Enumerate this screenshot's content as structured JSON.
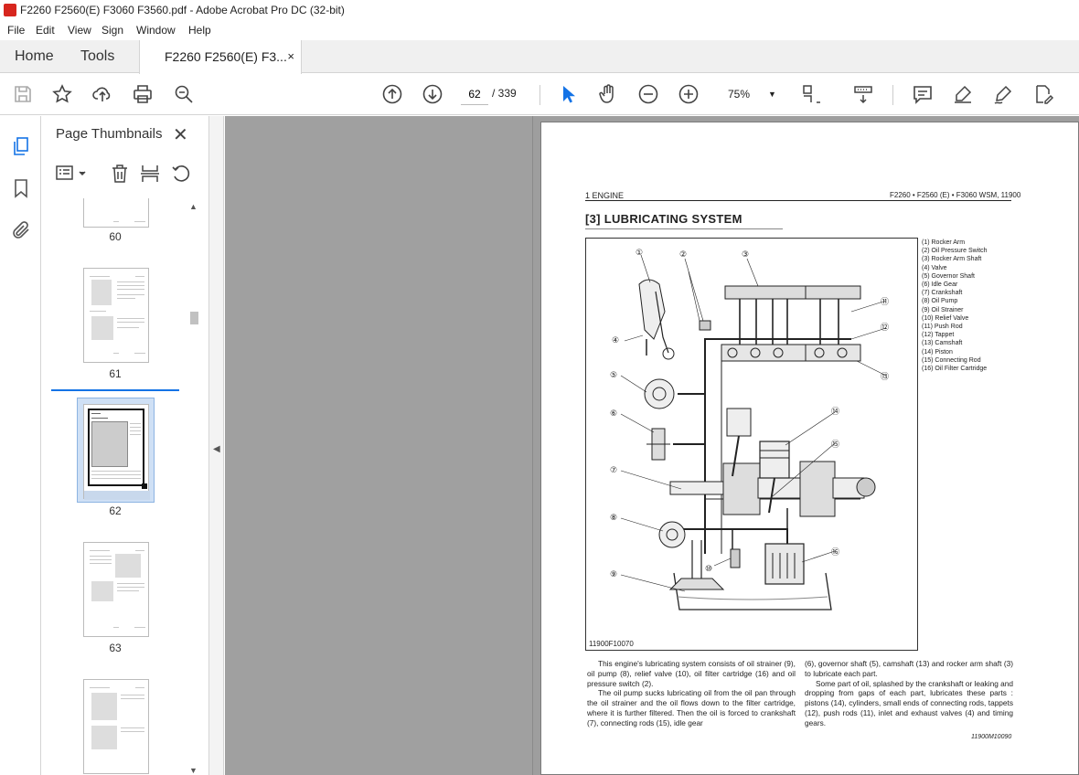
{
  "window": {
    "title": "F2260 F2560(E) F3060 F3560.pdf - Adobe Acrobat Pro DC (32-bit)"
  },
  "menu": [
    "File",
    "Edit",
    "View",
    "Sign",
    "Window",
    "Help"
  ],
  "tabs": {
    "home": "Home",
    "tools": "Tools",
    "document": "F2260 F2560(E) F3...",
    "close": "×"
  },
  "toolbar": {
    "current_page": "62",
    "total_pages": "/ 339",
    "zoom": "75%",
    "icons": [
      "save-icon",
      "star-icon",
      "upload-icon",
      "print-icon",
      "zoom-search-icon",
      "page-up-icon",
      "page-down-icon",
      "select-arrow-icon",
      "hand-icon",
      "zoom-out-icon",
      "zoom-in-icon",
      "fit-page-icon",
      "scroll-mode-icon",
      "comment-icon",
      "highlight-icon",
      "sign-icon",
      "edit-pdf-icon"
    ]
  },
  "rail": {
    "icons": [
      "page-thumbnails-icon",
      "bookmark-icon",
      "attachment-icon"
    ]
  },
  "thumbnails_panel": {
    "title": "Page Thumbnails",
    "close": "✕",
    "pages": [
      "60",
      "61",
      "62",
      "63"
    ],
    "selected": "62"
  },
  "document": {
    "header_left": "1 ENGINE",
    "header_right": "F2260 • F2560 (E) • F3060 WSM, 11900",
    "section_title": "[3]  LUBRICATING  SYSTEM",
    "figure_code": "11900F10070",
    "legend": [
      "(1)   Rocker Arm",
      "(2)   Oil Pressure Switch",
      "(3)   Rocker Arm Shaft",
      "(4)   Valve",
      "(5)   Governor Shaft",
      "(6)   Idle Gear",
      "(7)   Crankshaft",
      "(8)   Oil Pump",
      "(9)   Oil Strainer",
      "(10)  Relief Valve",
      "(11)  Push Rod",
      "(12)  Tappet",
      "(13)  Camshaft",
      "(14)  Piston",
      "(15)  Connecting Rod",
      "(16)  Oil Filter Cartridge"
    ],
    "callouts": [
      "①",
      "②",
      "③",
      "④",
      "⑤",
      "⑥",
      "⑦",
      "⑧",
      "⑨",
      "⑩",
      "⑪",
      "⑫",
      "⑬",
      "⑭",
      "⑮",
      "⑯"
    ],
    "para1": "This engine's lubricating system consists of oil strainer (9), oil pump (8), relief valve (10), oil filter cartridge (16) and oil pressure switch (2).",
    "para2": "The oil pump sucks lubricating oil from the oil pan through the oil strainer and the oil flows down to the filter cartridge, where it is further filtered.  Then the oil is forced to crankshaft (7), connecting rods (15), idle gear",
    "para3": "(6), governor shaft (5), camshaft (13) and rocker arm shaft (3) to lubricate each part.",
    "para4": "Some part of oil, splashed by the crankshaft or leaking and dropping from gaps of each part, lubricates these parts :  pistons (14), cylinders, small ends of connecting rods, tappets (12), push rods (11), inlet and exhaust valves (4) and timing gears.",
    "doc_ref": "11900M10090"
  },
  "colors": {
    "accent": "#1473e6",
    "doc_bg": "#9e9e9e",
    "brand": "#d7261e"
  }
}
